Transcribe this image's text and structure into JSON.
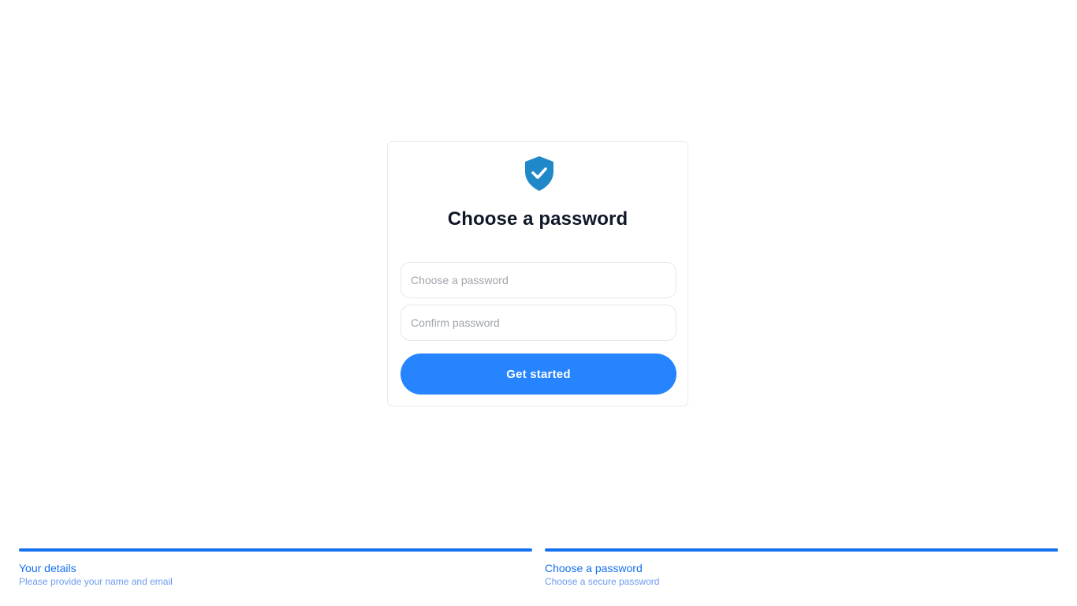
{
  "card": {
    "icon": "shield-check-icon",
    "title": "Choose a password",
    "password_placeholder": "Choose a password",
    "confirm_placeholder": "Confirm password",
    "submit_label": "Get started"
  },
  "steps": [
    {
      "label": "Your details",
      "description": "Please provide your name and email"
    },
    {
      "label": "Choose a password",
      "description": "Choose a secure password"
    }
  ],
  "colors": {
    "accent": "#2684ff",
    "icon": "#1e88c9",
    "step_bar": "#1570ef",
    "title": "#101828"
  }
}
